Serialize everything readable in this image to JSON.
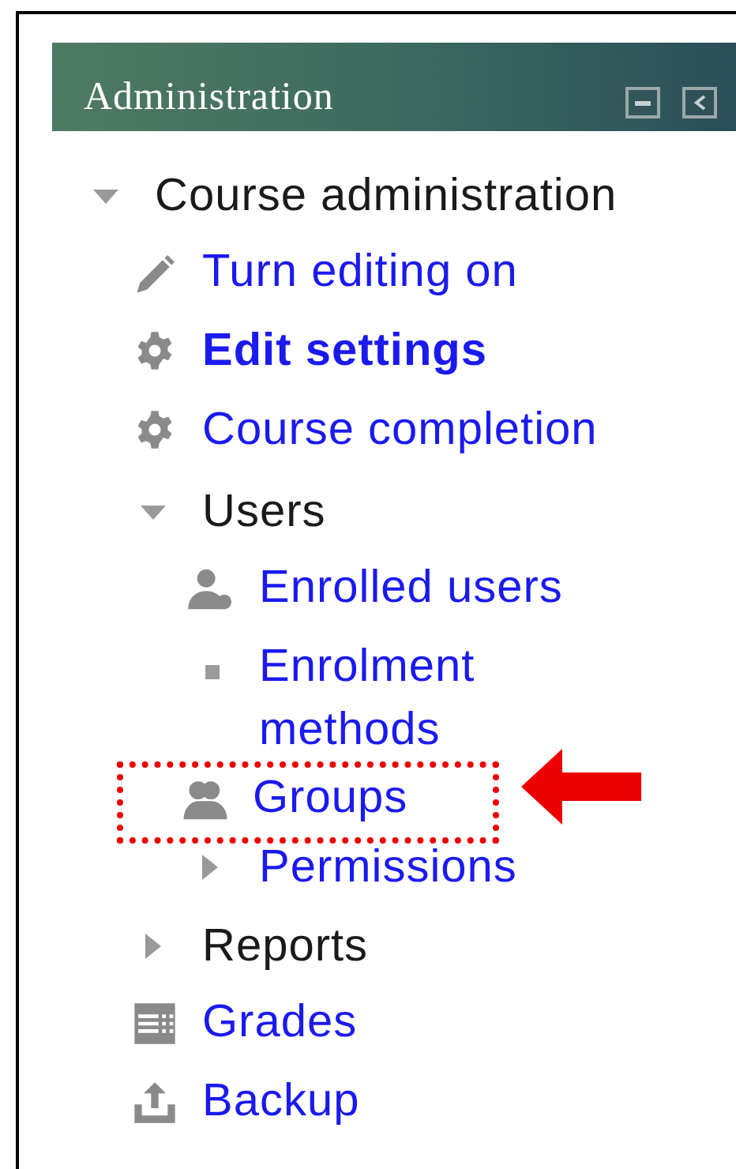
{
  "block": {
    "title": "Administration"
  },
  "tree": [
    {
      "kind": "branch",
      "label": "Course administration",
      "expanded": true,
      "link": false,
      "children": [
        {
          "kind": "edit",
          "label": "Turn editing on",
          "active": false,
          "highlighted": false
        },
        {
          "kind": "settings",
          "label": "Edit settings",
          "active": true,
          "highlighted": false
        },
        {
          "kind": "settings",
          "label": "Course completion",
          "active": false,
          "highlighted": false
        },
        {
          "kind": "branch",
          "label": "Users",
          "expanded": true,
          "link": false,
          "children": [
            {
              "kind": "users",
              "label": "Enrolled users",
              "active": false,
              "highlighted": false
            },
            {
              "kind": "bullet",
              "label": "Enrolment methods",
              "active": false,
              "highlighted": false
            },
            {
              "kind": "groups",
              "label": "Groups",
              "active": false,
              "highlighted": true
            },
            {
              "kind": "branch",
              "label": "Permissions",
              "expanded": false,
              "link": true
            }
          ]
        },
        {
          "kind": "branch",
          "label": "Reports",
          "expanded": false,
          "link": false
        },
        {
          "kind": "grades",
          "label": "Grades",
          "active": false,
          "highlighted": false
        },
        {
          "kind": "backup",
          "label": "Backup",
          "active": false,
          "highlighted": false
        }
      ]
    }
  ]
}
